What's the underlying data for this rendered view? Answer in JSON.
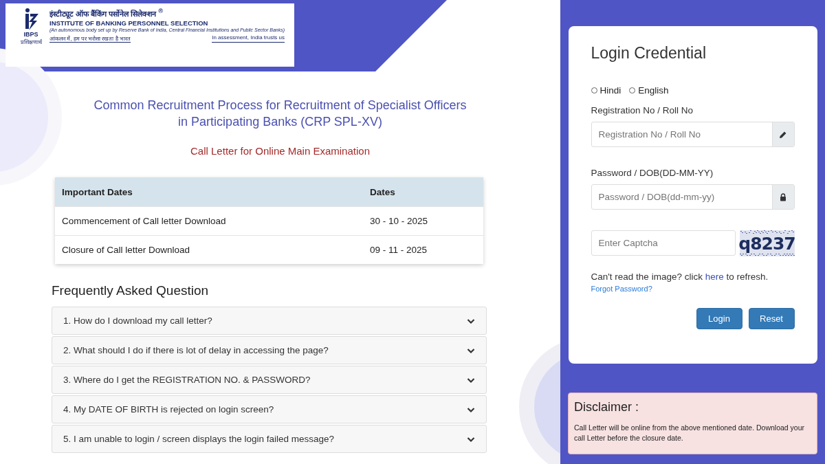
{
  "logo": {
    "abbr": "IBPS",
    "abbr_hindi": "प्रशिक्षणार्थ",
    "name_hindi": "इंस्टीट्यूट ऑफ बैंकिंग पर्सोनेल सिलेक्शन",
    "registered": "®",
    "name": "INSTITUTE OF BANKING PERSONNEL SELECTION",
    "subtitle": "(An autonomous body set up by Reserve Bank of India, Central Financial Institutions and Public Sector Banks)",
    "motto_hindi": "आंकलन में, हम पर भरोसा रखता है भारत",
    "motto": "In assessment, India trusts us"
  },
  "title": "Common Recruitment Process for Recruitment of Specialist Officers in Participating Banks (CRP SPL-XV)",
  "subtitle": "Call Letter for Online Main Examination",
  "dates_table": {
    "columns": [
      "Important Dates",
      "Dates"
    ],
    "rows": [
      [
        "Commencement of Call letter Download",
        "30 - 10 - 2025"
      ],
      [
        "Closure of Call letter Download",
        "09 - 11 - 2025"
      ]
    ]
  },
  "faq": {
    "heading": "Frequently Asked Question",
    "items": [
      {
        "question": "1. How do I download my call letter?",
        "expanded": false
      },
      {
        "question": "2. What should I do if there is lot of delay in accessing the page?",
        "expanded": false
      },
      {
        "question": "3. Where do I get the REGISTRATION NO. & PASSWORD?",
        "expanded": false
      },
      {
        "question": "4. My DATE OF BIRTH is rejected on login screen?",
        "expanded": false
      },
      {
        "question": "5. I am unable to login / screen displays the login failed message?",
        "expanded": false
      }
    ]
  },
  "login": {
    "title": "Login Credential",
    "languages": [
      {
        "label": "Hindi",
        "selected": false
      },
      {
        "label": "English",
        "selected": false
      }
    ],
    "fields": [
      {
        "label": "Registration No / Roll No",
        "placeholder": "Registration No / Roll No",
        "kind": "pencil"
      },
      {
        "label": "Password / DOB(DD-MM-YY)",
        "placeholder": "Password / DOB(dd-mm-yy)",
        "kind": "lock"
      }
    ],
    "captcha": {
      "placeholder": "Enter Captcha",
      "text": "q8237"
    },
    "refresh": {
      "before": "Can't read the image? click",
      "link": "here",
      "after": "to refresh."
    },
    "forgot": "Forgot Password?",
    "buttons": [
      "Login",
      "Reset"
    ]
  },
  "disclaimer": {
    "title": "Disclaimer :",
    "text": "Call Letter will be online from the above mentioned date. Download your call Letter before the closure date."
  }
}
